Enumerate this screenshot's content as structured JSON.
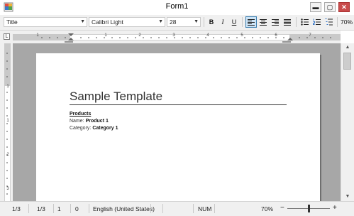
{
  "window": {
    "title": "Form1",
    "minimize_glyph": "▬",
    "maximize_glyph": "▢",
    "close_glyph": "✕"
  },
  "toolbar": {
    "style_value": "Title",
    "font_value": "Calibri Light",
    "size_value": "28",
    "bold": "B",
    "italic": "I",
    "underline": "U",
    "zoom": "70%"
  },
  "ruler": {
    "tab_marker": "L"
  },
  "document": {
    "title": "Sample Template",
    "section_heading": "Products",
    "name_label": "Name:",
    "name_value": "Product 1",
    "category_label": "Category:",
    "category_value": "Category 1"
  },
  "status": {
    "page": "1/3",
    "section": "1/3",
    "line": "1",
    "column": "0",
    "language": "English (United States)",
    "num": "NUM",
    "zoom": "70%",
    "zoom_out": "−",
    "zoom_in": "+"
  },
  "icons": [
    "app-icon",
    "minimize-icon",
    "maximize-icon",
    "close-icon",
    "bold-icon",
    "italic-icon",
    "underline-icon",
    "align-left-icon",
    "align-center-icon",
    "align-right-icon",
    "justify-icon",
    "bullets-icon",
    "numbering-icon",
    "multilevel-list-icon"
  ]
}
